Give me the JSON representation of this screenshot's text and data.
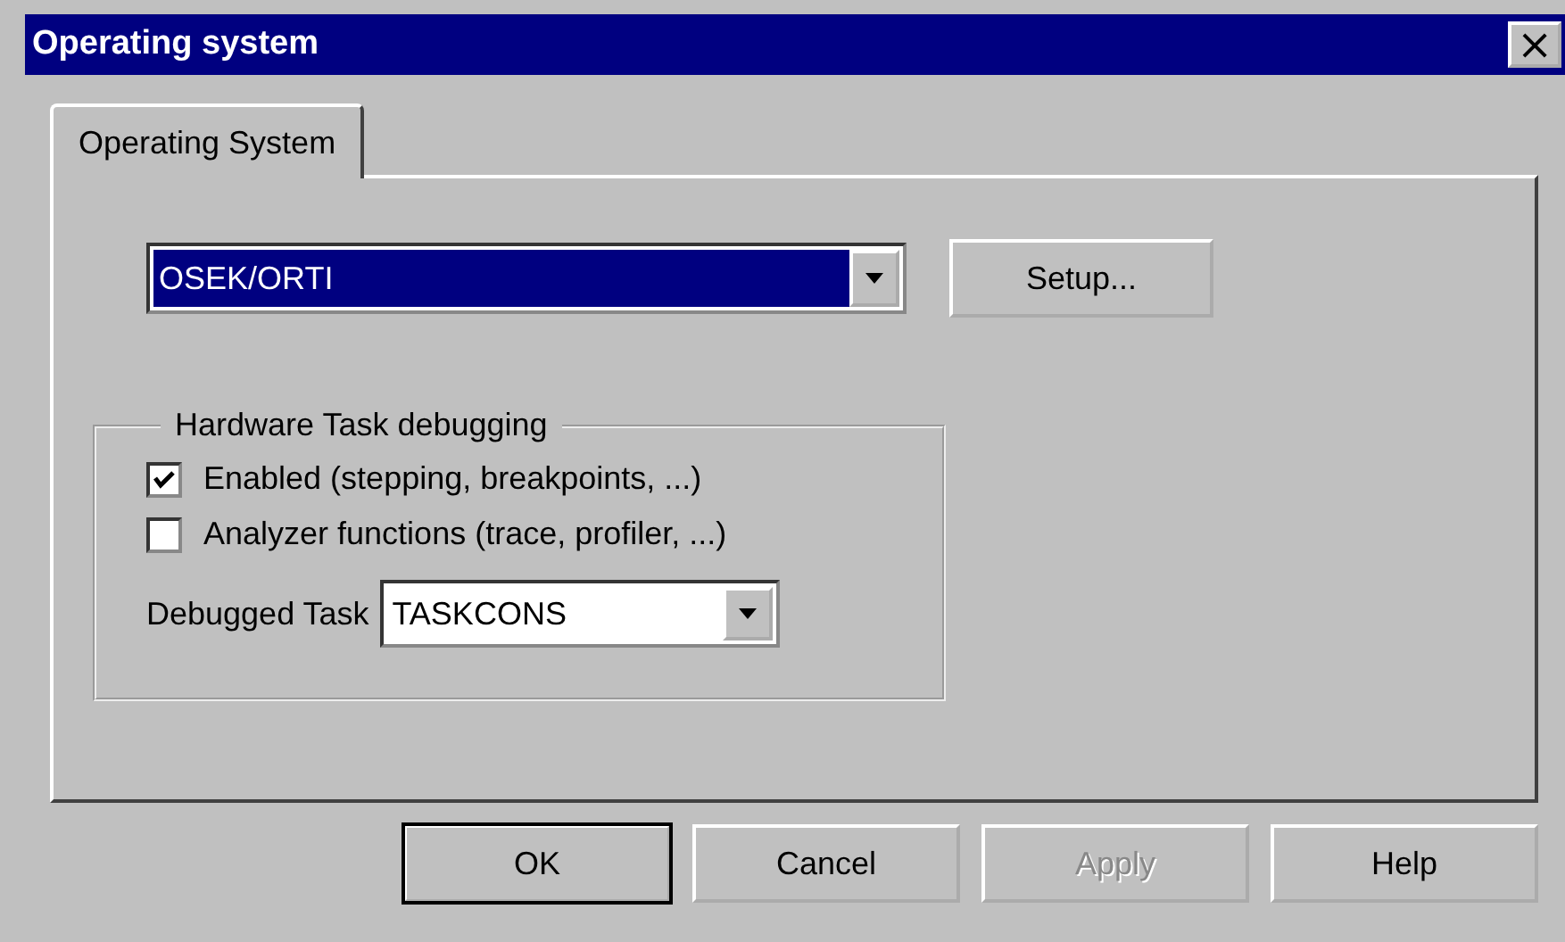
{
  "window": {
    "title": "Operating system",
    "close": "×"
  },
  "tabs": [
    {
      "label": "Operating System",
      "selected": true
    }
  ],
  "os_select": {
    "value": "OSEK/ORTI",
    "focused": true
  },
  "setup_button": "Setup...",
  "group": {
    "title": "Hardware Task debugging",
    "options": [
      {
        "label": "Enabled (stepping, breakpoints, ...)",
        "checked": true
      },
      {
        "label": "Analyzer functions (trace, profiler, ...)",
        "checked": false
      }
    ],
    "task_label": "Debugged Task",
    "task_value": "TASKCONS"
  },
  "buttons": [
    {
      "label": "OK",
      "default": true,
      "disabled": false
    },
    {
      "label": "Cancel",
      "default": false,
      "disabled": false
    },
    {
      "label": "Apply",
      "default": false,
      "disabled": true
    },
    {
      "label": "Help",
      "default": false,
      "disabled": false
    }
  ]
}
